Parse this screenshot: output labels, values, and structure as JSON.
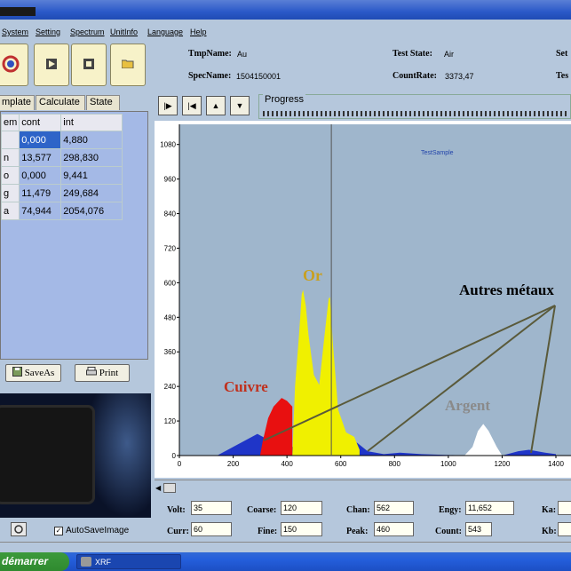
{
  "menu": [
    "System",
    "Setting",
    "Spectrum",
    "UnitInfo",
    "Language",
    "Help"
  ],
  "toolbar_icons": [
    "xrf-logo-icon",
    "play-icon",
    "stop-icon",
    "folder-icon"
  ],
  "info": {
    "tmpname_label": "TmpName:",
    "tmpname_value": "Au",
    "specname_label": "SpecName:",
    "specname_value": "1504150001",
    "test_state_label": "Test  State:",
    "test_state_value": "Air",
    "countrate_label": "CountRate:",
    "countrate_value": "3373,47",
    "cut_label_1": "Set",
    "cut_label_2": "Tes"
  },
  "tabs": [
    "mplate",
    "Calculate",
    "State"
  ],
  "table": {
    "headers": [
      "em",
      "cont",
      "int"
    ],
    "rows": [
      {
        "c0": "",
        "cont": "0,000",
        "int": "4,880"
      },
      {
        "c0": "n",
        "cont": "13,577",
        "int": "298,830"
      },
      {
        "c0": "o",
        "cont": "0,000",
        "int": "9,441"
      },
      {
        "c0": "g",
        "cont": "11,479",
        "int": "249,684"
      },
      {
        "c0": "a",
        "cont": "74,944",
        "int": "2054,076"
      }
    ]
  },
  "buttons": {
    "save_as": "SaveAs",
    "print": "Print"
  },
  "autosave_label": "AutoSaveImage",
  "progress_label": "Progress",
  "chart_data": {
    "type": "area",
    "title": "TestSample",
    "xlim": [
      0,
      1400
    ],
    "ylim": [
      0,
      1150
    ],
    "x_ticks": [
      0,
      200,
      400,
      600,
      800,
      1000,
      1200,
      1400
    ],
    "y_ticks": [
      0,
      120,
      240,
      360,
      480,
      600,
      720,
      840,
      960,
      1080
    ],
    "cursor_x": 565,
    "annotations": [
      {
        "text": "Or",
        "color": "#c8a020"
      },
      {
        "text": "Cuivre",
        "color": "#c0301c"
      },
      {
        "text": "Argent",
        "color": "#8a8a8a"
      },
      {
        "text": "Autres métaux",
        "color": "#000000"
      }
    ],
    "series": [
      {
        "color": "#1f35c8",
        "points": [
          [
            140,
            0
          ],
          [
            200,
            30
          ],
          [
            250,
            55
          ],
          [
            290,
            75
          ],
          [
            330,
            55
          ],
          [
            420,
            30
          ],
          [
            460,
            20
          ],
          [
            560,
            15
          ],
          [
            600,
            30
          ],
          [
            660,
            45
          ],
          [
            700,
            15
          ],
          [
            760,
            5
          ],
          [
            820,
            10
          ],
          [
            900,
            5
          ],
          [
            1000,
            2
          ],
          [
            1080,
            0
          ],
          [
            1200,
            0
          ],
          [
            1260,
            15
          ],
          [
            1300,
            20
          ],
          [
            1360,
            10
          ],
          [
            1400,
            5
          ]
        ]
      },
      {
        "color": "#e81010",
        "points": [
          [
            300,
            0
          ],
          [
            310,
            50
          ],
          [
            330,
            130
          ],
          [
            350,
            170
          ],
          [
            380,
            200
          ],
          [
            400,
            190
          ],
          [
            420,
            170
          ]
        ]
      },
      {
        "color": "#f0f000",
        "points": [
          [
            420,
            0
          ],
          [
            430,
            240
          ],
          [
            445,
            420
          ],
          [
            455,
            560
          ],
          [
            460,
            575
          ],
          [
            470,
            520
          ],
          [
            480,
            420
          ],
          [
            500,
            280
          ],
          [
            520,
            245
          ],
          [
            540,
            420
          ],
          [
            555,
            545
          ],
          [
            560,
            550
          ],
          [
            570,
            400
          ],
          [
            590,
            160
          ],
          [
            620,
            80
          ],
          [
            650,
            65
          ],
          [
            670,
            20
          ]
        ]
      },
      {
        "color": "#ffffff",
        "points": [
          [
            1060,
            0
          ],
          [
            1090,
            30
          ],
          [
            1110,
            85
          ],
          [
            1130,
            110
          ],
          [
            1150,
            85
          ],
          [
            1180,
            30
          ],
          [
            1200,
            0
          ]
        ]
      }
    ]
  }
}
